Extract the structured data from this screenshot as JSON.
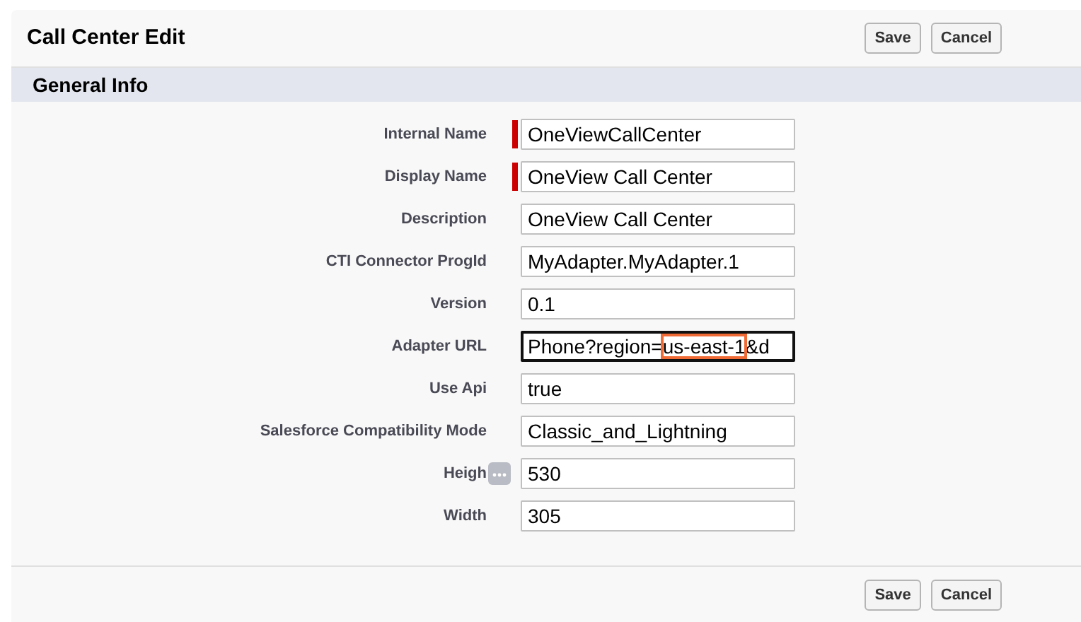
{
  "header": {
    "title": "Call Center Edit",
    "buttons": [
      "Save",
      "Cancel"
    ]
  },
  "section": {
    "title": "General Info"
  },
  "fields": [
    {
      "label": "Internal Name",
      "required": true,
      "focused": false,
      "segments": [
        {
          "text": "OneViewCallCenter",
          "highlighted": false
        }
      ]
    },
    {
      "label": "Display Name",
      "required": true,
      "focused": false,
      "segments": [
        {
          "text": "OneView Call Center",
          "highlighted": false
        }
      ]
    },
    {
      "label": "Description",
      "required": false,
      "focused": false,
      "segments": [
        {
          "text": "OneView Call Center",
          "highlighted": false
        }
      ]
    },
    {
      "label": "CTI Connector ProgId",
      "required": false,
      "focused": false,
      "segments": [
        {
          "text": "MyAdapter.MyAdapter.1",
          "highlighted": false
        }
      ]
    },
    {
      "label": "Version",
      "required": false,
      "focused": false,
      "segments": [
        {
          "text": "0.1",
          "highlighted": false
        }
      ]
    },
    {
      "label": "Adapter URL",
      "required": false,
      "focused": true,
      "segments": [
        {
          "text": "Phone?region=",
          "highlighted": false
        },
        {
          "text": "us-east-1",
          "highlighted": true
        },
        {
          "text": "&d",
          "highlighted": false
        }
      ]
    },
    {
      "label": "Use Api",
      "required": false,
      "focused": false,
      "segments": [
        {
          "text": "true",
          "highlighted": false
        }
      ]
    },
    {
      "label": "Salesforce Compatibility Mode",
      "required": false,
      "focused": false,
      "segments": [
        {
          "text": "Classic_and_Lightning",
          "highlighted": false
        }
      ]
    },
    {
      "label": "Heigh",
      "label_overflow": true,
      "required": false,
      "focused": false,
      "segments": [
        {
          "text": "530",
          "highlighted": false
        }
      ]
    },
    {
      "label": "Width",
      "required": false,
      "focused": false,
      "segments": [
        {
          "text": "305",
          "highlighted": false
        }
      ]
    }
  ],
  "footer": {
    "buttons": [
      "Save",
      "Cancel"
    ]
  }
}
